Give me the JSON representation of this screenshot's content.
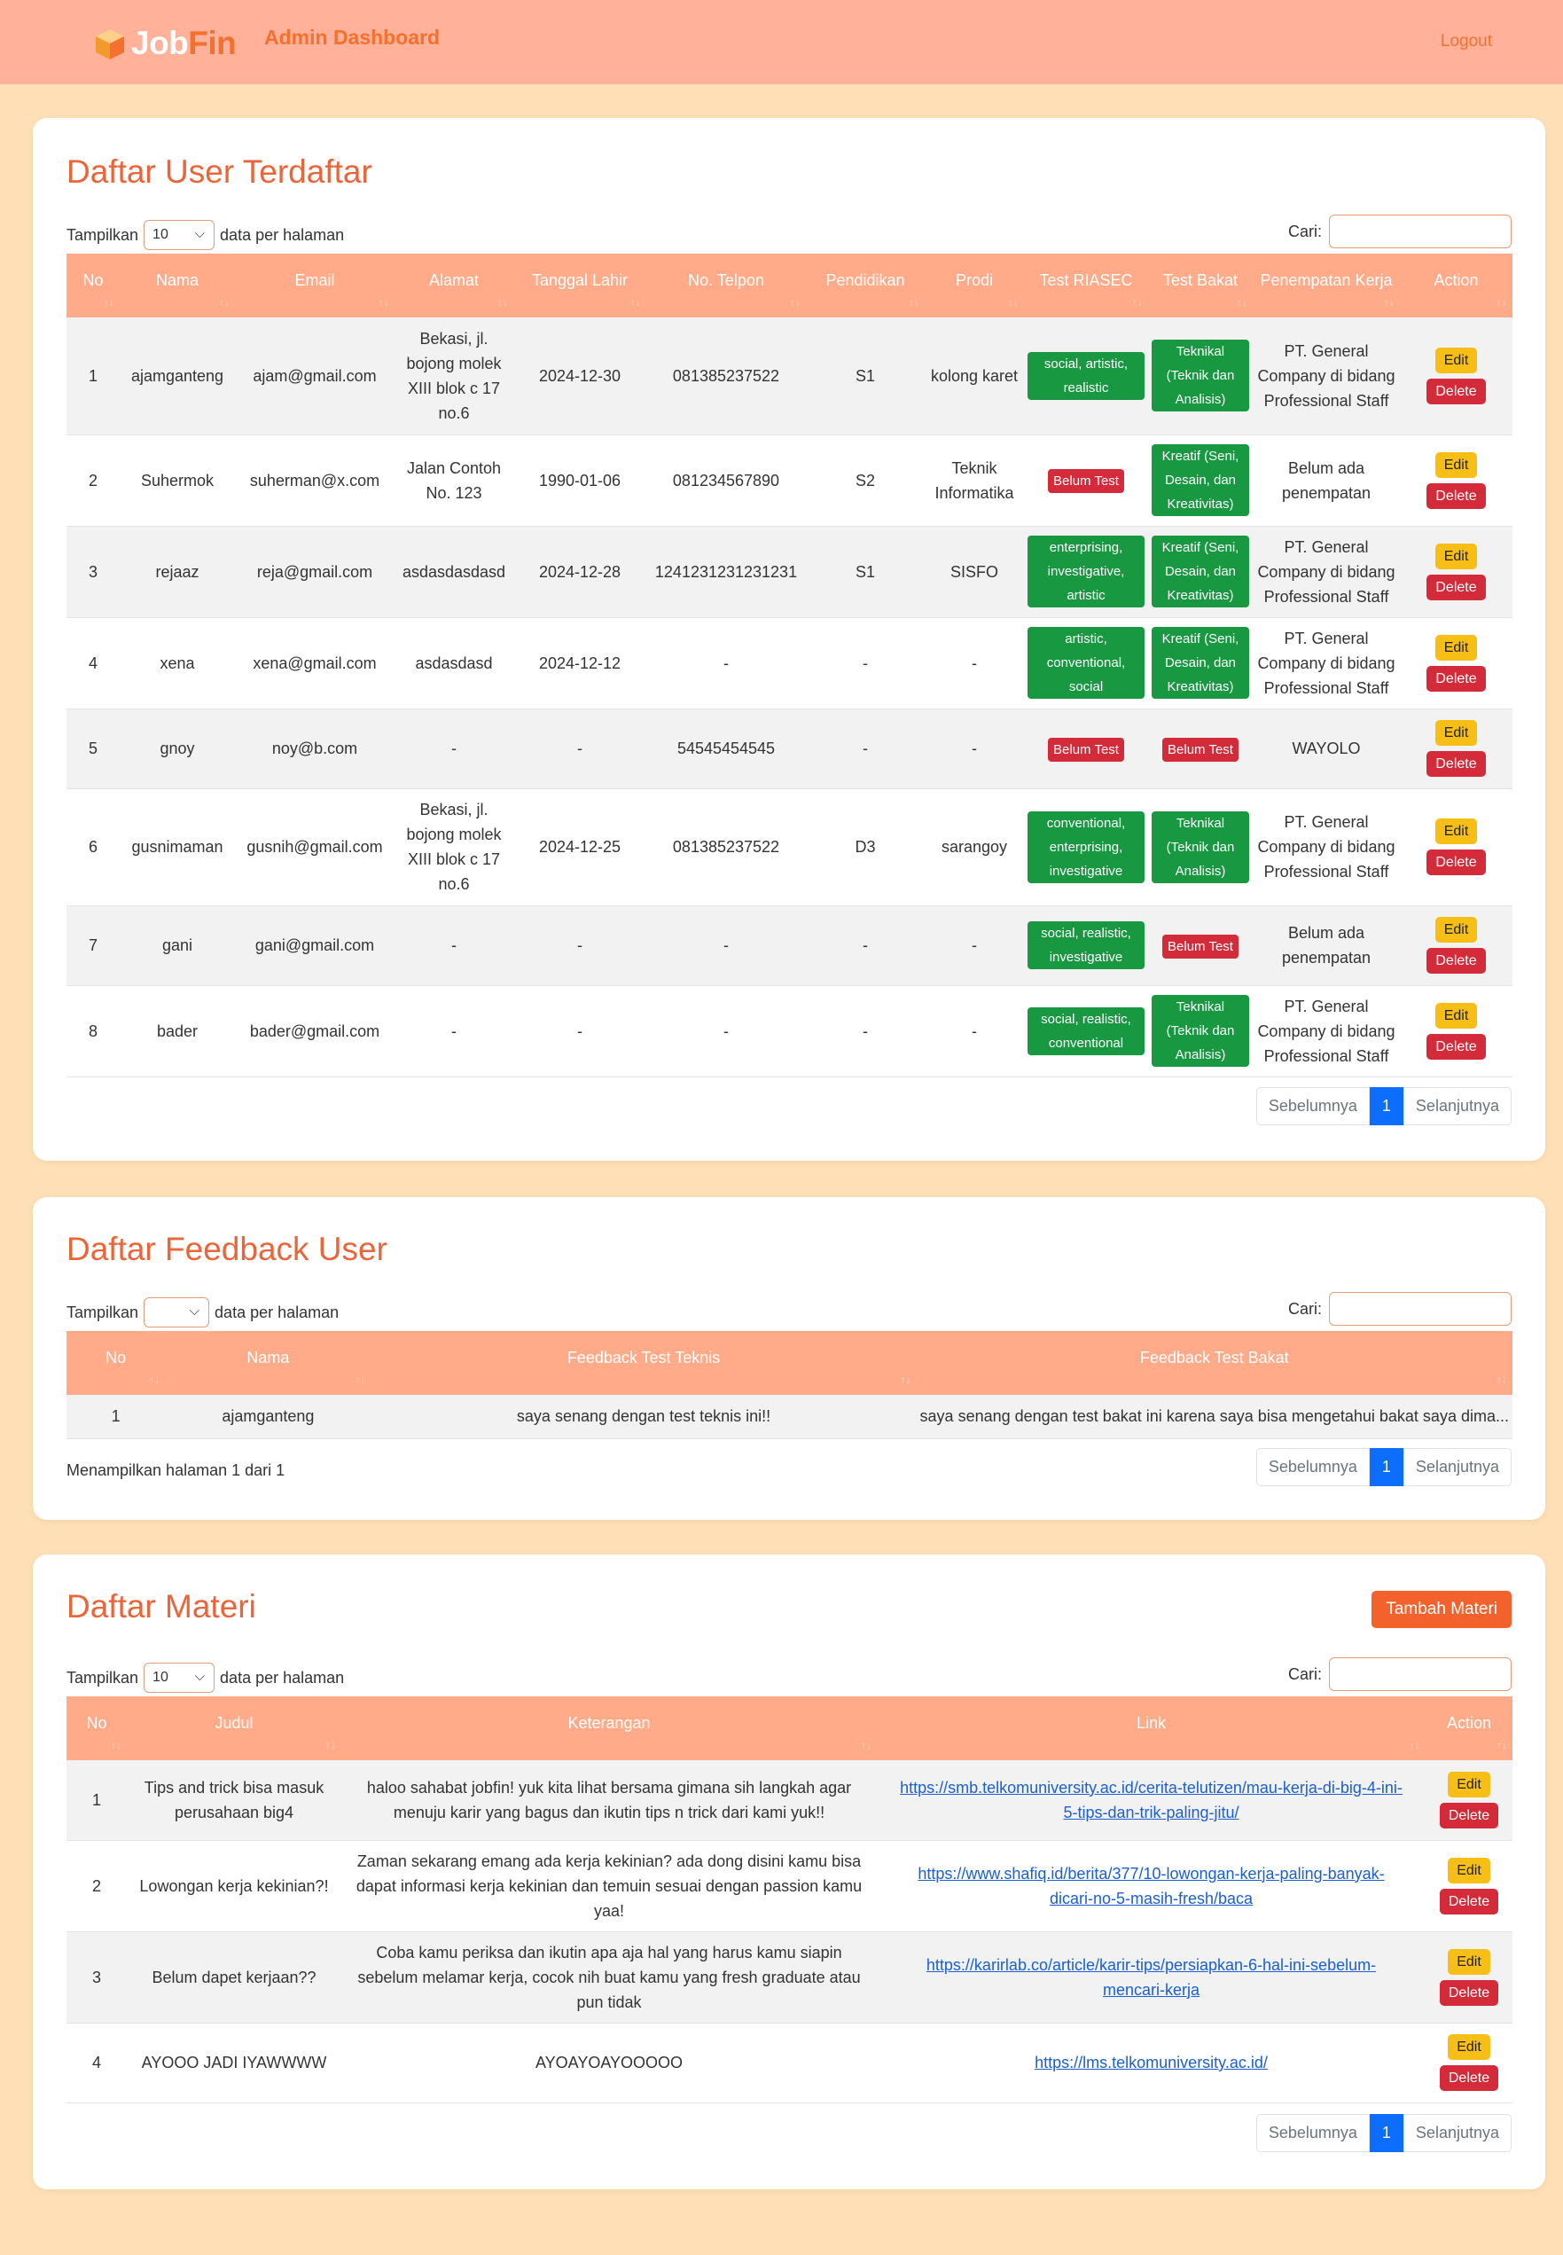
{
  "brand": {
    "logo_word_white": "Job",
    "logo_word_orange": "Fin",
    "dashboard_title": "Admin Dashboard",
    "logout": "Logout"
  },
  "colors": {
    "navbar": "#ffb199",
    "accent": "#f3702e",
    "page_bg": "#ffe0b6",
    "table_header": "#ffaa89"
  },
  "users": {
    "title": "Daftar User Terdaftar",
    "show_label": "Tampilkan",
    "page_size": "10",
    "per_page_label": "data per halaman",
    "search_label": "Cari:",
    "columns": [
      "No",
      "Nama",
      "Email",
      "Alamat",
      "Tanggal Lahir",
      "No. Telpon",
      "Pendidikan",
      "Prodi",
      "Test RIASEC",
      "Test Bakat",
      "Penempatan Kerja",
      "Action"
    ],
    "rows": [
      {
        "no": "1",
        "nama": "ajamganteng",
        "email": "ajam@gmail.com",
        "alamat": "Bekasi, jl. bojong molek XIII blok c 17 no.6",
        "tgl": "2024-12-30",
        "telp": "081385237522",
        "pendidikan": "S1",
        "prodi": "kolong karet",
        "riasec": "social, artistic, realistic",
        "riasec_status": "done",
        "bakat": "Teknikal (Teknik dan Analisis)",
        "bakat_status": "done",
        "penempatan": "PT. General Company di bidang Professional Staff"
      },
      {
        "no": "2",
        "nama": "Suhermok",
        "email": "suherman@x.com",
        "alamat": "Jalan Contoh No. 123",
        "tgl": "1990-01-06",
        "telp": "081234567890",
        "pendidikan": "S2",
        "prodi": "Teknik Informatika",
        "riasec": "Belum Test",
        "riasec_status": "none",
        "bakat": "Kreatif (Seni, Desain, dan Kreativitas)",
        "bakat_status": "done",
        "penempatan": "Belum ada penempatan"
      },
      {
        "no": "3",
        "nama": "rejaaz",
        "email": "reja@gmail.com",
        "alamat": "asdasdasdasd",
        "tgl": "2024-12-28",
        "telp": "1241231231231231",
        "pendidikan": "S1",
        "prodi": "SISFO",
        "riasec": "enterprising, investigative, artistic",
        "riasec_status": "done",
        "bakat": "Kreatif (Seni, Desain, dan Kreativitas)",
        "bakat_status": "done",
        "penempatan": "PT. General Company di bidang Professional Staff"
      },
      {
        "no": "4",
        "nama": "xena",
        "email": "xena@gmail.com",
        "alamat": "asdasdasd",
        "tgl": "2024-12-12",
        "telp": "-",
        "pendidikan": "-",
        "prodi": "-",
        "riasec": "artistic, conventional, social",
        "riasec_status": "done",
        "bakat": "Kreatif (Seni, Desain, dan Kreativitas)",
        "bakat_status": "done",
        "penempatan": "PT. General Company di bidang Professional Staff"
      },
      {
        "no": "5",
        "nama": "gnoy",
        "email": "noy@b.com",
        "alamat": "-",
        "tgl": "-",
        "telp": "54545454545",
        "pendidikan": "-",
        "prodi": "-",
        "riasec": "Belum Test",
        "riasec_status": "none",
        "bakat": "Belum Test",
        "bakat_status": "none",
        "penempatan": "WAYOLO"
      },
      {
        "no": "6",
        "nama": "gusnimaman",
        "email": "gusnih@gmail.com",
        "alamat": "Bekasi, jl. bojong molek XIII blok c 17 no.6",
        "tgl": "2024-12-25",
        "telp": "081385237522",
        "pendidikan": "D3",
        "prodi": "sarangoy",
        "riasec": "conventional, enterprising, investigative",
        "riasec_status": "done",
        "bakat": "Teknikal (Teknik dan Analisis)",
        "bakat_status": "done",
        "penempatan": "PT. General Company di bidang Professional Staff"
      },
      {
        "no": "7",
        "nama": "gani",
        "email": "gani@gmail.com",
        "alamat": "-",
        "tgl": "-",
        "telp": "-",
        "pendidikan": "-",
        "prodi": "-",
        "riasec": "social, realistic, investigative",
        "riasec_status": "done",
        "bakat": "Belum Test",
        "bakat_status": "none",
        "penempatan": "Belum ada penempatan"
      },
      {
        "no": "8",
        "nama": "bader",
        "email": "bader@gmail.com",
        "alamat": "-",
        "tgl": "-",
        "telp": "-",
        "pendidikan": "-",
        "prodi": "-",
        "riasec": "social, realistic, conventional",
        "riasec_status": "done",
        "bakat": "Teknikal (Teknik dan Analisis)",
        "bakat_status": "done",
        "penempatan": "PT. General Company di bidang Professional Staff"
      }
    ],
    "edit": "Edit",
    "delete": "Delete",
    "pager": {
      "prev": "Sebelumnya",
      "page": "1",
      "next": "Selanjutnya"
    }
  },
  "feedback": {
    "title": "Daftar Feedback User",
    "show_label": "Tampilkan",
    "page_size": "",
    "per_page_label": "data per halaman",
    "search_label": "Cari:",
    "columns": [
      "No",
      "Nama",
      "Feedback Test Teknis",
      "Feedback Test Bakat"
    ],
    "rows": [
      {
        "no": "1",
        "nama": "ajamganteng",
        "teknis": "saya senang dengan test teknis ini!!",
        "bakat": "saya senang dengan test bakat ini karena saya bisa mengetahui bakat saya dima..."
      }
    ],
    "info": "Menampilkan halaman 1 dari 1",
    "pager": {
      "prev": "Sebelumnya",
      "page": "1",
      "next": "Selanjutnya"
    }
  },
  "materi": {
    "title": "Daftar Materi",
    "add_button": "Tambah Materi",
    "show_label": "Tampilkan",
    "page_size": "10",
    "per_page_label": "data per halaman",
    "search_label": "Cari:",
    "columns": [
      "No",
      "Judul",
      "Keterangan",
      "Link",
      "Action"
    ],
    "rows": [
      {
        "no": "1",
        "judul": "Tips and trick bisa masuk perusahaan big4",
        "ket": "haloo sahabat jobfin! yuk kita lihat bersama gimana sih langkah agar menuju karir yang bagus dan ikutin tips n trick dari kami yuk!!",
        "link": "https://smb.telkomuniversity.ac.id/cerita-telutizen/mau-kerja-di-big-4-ini-5-tips-dan-trik-paling-jitu/"
      },
      {
        "no": "2",
        "judul": "Lowongan kerja kekinian?!",
        "ket": "Zaman sekarang emang ada kerja kekinian? ada dong disini kamu bisa dapat informasi kerja kekinian dan temuin sesuai dengan passion kamu yaa!",
        "link": "https://www.shafiq.id/berita/377/10-lowongan-kerja-paling-banyak-dicari-no-5-masih-fresh/baca"
      },
      {
        "no": "3",
        "judul": "Belum dapet kerjaan??",
        "ket": "Coba kamu periksa dan ikutin apa aja hal yang harus kamu siapin sebelum melamar kerja, cocok nih buat kamu yang fresh graduate atau pun tidak",
        "link": "https://karirlab.co/article/karir-tips/persiapkan-6-hal-ini-sebelum-mencari-kerja"
      },
      {
        "no": "4",
        "judul": "AYOOO JADI IYAWWWW",
        "ket": "AYOAYOAYOOOOO",
        "link": "https://lms.telkomuniversity.ac.id/"
      }
    ],
    "edit": "Edit",
    "delete": "Delete",
    "pager": {
      "prev": "Sebelumnya",
      "page": "1",
      "next": "Selanjutnya"
    }
  }
}
